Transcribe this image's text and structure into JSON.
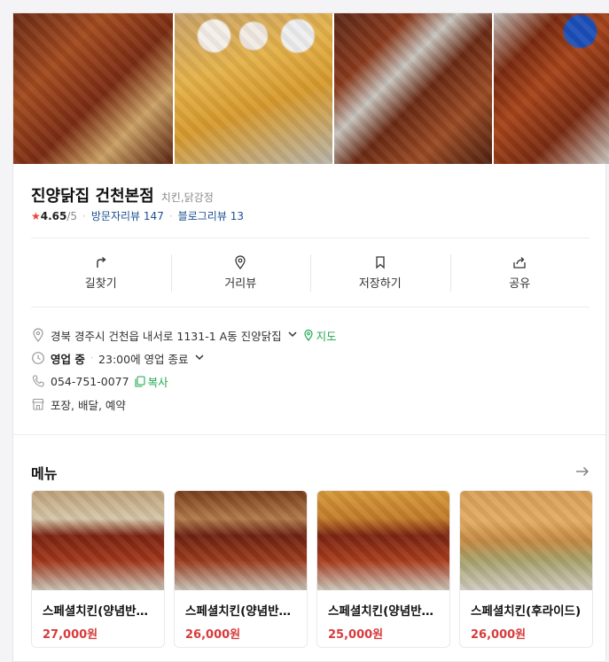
{
  "place": {
    "name": "진양닭집 건천본점",
    "category": "치킨,닭강정",
    "rating": "4.65",
    "rating_max": "/5",
    "visitor_reviews_label": "방문자리뷰",
    "visitor_reviews_count": "147",
    "blog_reviews_label": "블로그리뷰",
    "blog_reviews_count": "13"
  },
  "actions": [
    {
      "label": "길찾기",
      "icon": "directions-icon"
    },
    {
      "label": "거리뷰",
      "icon": "location-pin-icon"
    },
    {
      "label": "저장하기",
      "icon": "bookmark-icon"
    },
    {
      "label": "공유",
      "icon": "share-icon"
    }
  ],
  "info": {
    "address": "경북 경주시 건천읍 내서로 1131-1 A동 진양닭집",
    "map_label": "지도",
    "status": "영업 중",
    "hours": "23:00에 영업 종료",
    "phone": "054-751-0077",
    "copy_label": "복사",
    "services": "포장, 배달, 예약"
  },
  "menu": {
    "title": "메뉴",
    "items": [
      {
        "name": "스페셜치킨(양념반후라이드반)",
        "price": "27,000원"
      },
      {
        "name": "스페셜치킨(양념반후라이드반)",
        "price": "26,000원"
      },
      {
        "name": "스페셜치킨(양념반후라이드반)",
        "price": "25,000원"
      },
      {
        "name": "스페셜치킨(후라이드)",
        "price": "26,000원"
      }
    ]
  },
  "colors": {
    "accent_green": "#1fa84f",
    "price_red": "#d83b3b",
    "link_blue": "#1d4f91",
    "star_red": "#e8463a"
  }
}
